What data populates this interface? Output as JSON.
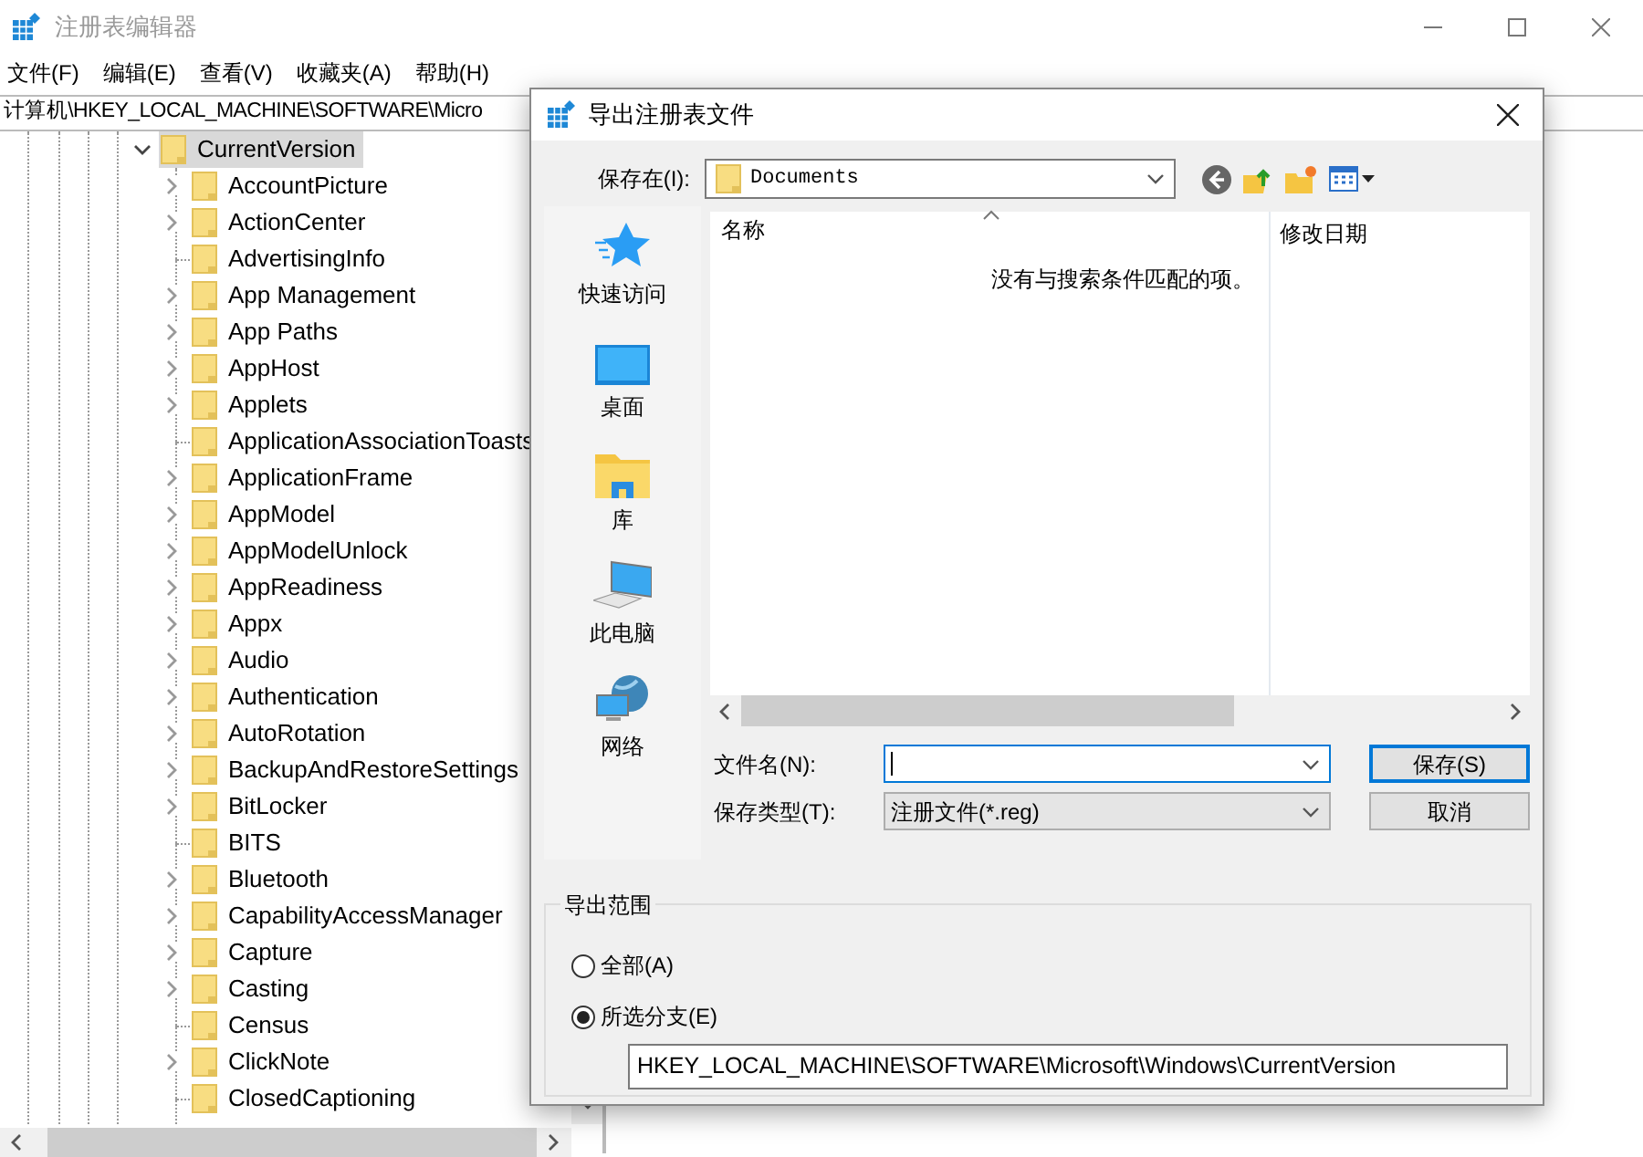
{
  "window": {
    "title": "注册表编辑器"
  },
  "menu": [
    "文件(F)",
    "编辑(E)",
    "查看(V)",
    "收藏夹(A)",
    "帮助(H)"
  ],
  "address_bar": {
    "value": "计算机\\HKEY_LOCAL_MACHINE\\SOFTWARE\\Micro"
  },
  "tree": [
    {
      "label": "CurrentVersion",
      "expanded": true,
      "selected": true,
      "children": [
        {
          "label": "AccountPicture",
          "expandable": true,
          "selected": false
        },
        {
          "label": "ActionCenter",
          "expandable": true,
          "selected": false
        },
        {
          "label": "AdvertisingInfo",
          "expandable": false,
          "selected": false
        },
        {
          "label": "App Management",
          "expandable": true,
          "selected": false
        },
        {
          "label": "App Paths",
          "expandable": true,
          "selected": false
        },
        {
          "label": "AppHost",
          "expandable": true,
          "selected": false
        },
        {
          "label": "Applets",
          "expandable": true,
          "selected": false
        },
        {
          "label": "ApplicationAssociationToasts",
          "expandable": false,
          "selected": false
        },
        {
          "label": "ApplicationFrame",
          "expandable": true,
          "selected": false
        },
        {
          "label": "AppModel",
          "expandable": true,
          "selected": false
        },
        {
          "label": "AppModelUnlock",
          "expandable": true,
          "selected": false
        },
        {
          "label": "AppReadiness",
          "expandable": true,
          "selected": false
        },
        {
          "label": "Appx",
          "expandable": true,
          "selected": false
        },
        {
          "label": "Audio",
          "expandable": true,
          "selected": false
        },
        {
          "label": "Authentication",
          "expandable": true,
          "selected": false
        },
        {
          "label": "AutoRotation",
          "expandable": true,
          "selected": false
        },
        {
          "label": "BackupAndRestoreSettings",
          "expandable": true,
          "selected": false
        },
        {
          "label": "BitLocker",
          "expandable": true,
          "selected": false
        },
        {
          "label": "BITS",
          "expandable": false,
          "selected": false
        },
        {
          "label": "Bluetooth",
          "expandable": true,
          "selected": false
        },
        {
          "label": "CapabilityAccessManager",
          "expandable": true,
          "selected": false
        },
        {
          "label": "Capture",
          "expandable": true,
          "selected": false
        },
        {
          "label": "Casting",
          "expandable": true,
          "selected": false
        },
        {
          "label": "Census",
          "expandable": false,
          "selected": false
        },
        {
          "label": "ClickNote",
          "expandable": true,
          "selected": false
        },
        {
          "label": "ClosedCaptioning",
          "expandable": false,
          "selected": false
        }
      ]
    }
  ],
  "dialog": {
    "title": "导出注册表文件",
    "save_in": {
      "label": "保存在(I):",
      "value": "Documents"
    },
    "places": [
      {
        "label": "快速访问",
        "kind": "star"
      },
      {
        "label": "桌面",
        "kind": "desktop"
      },
      {
        "label": "库",
        "kind": "library"
      },
      {
        "label": "此电脑",
        "kind": "computer"
      },
      {
        "label": "网络",
        "kind": "network"
      }
    ],
    "columns": [
      "名称",
      "修改日期"
    ],
    "empty_message": "没有与搜索条件匹配的项。",
    "file_name": {
      "label": "文件名(N):"
    },
    "file_type": {
      "label": "保存类型(T):",
      "value": "注册文件(*.reg)"
    },
    "buttons": [
      {
        "label": "保存(S)",
        "default": true
      },
      {
        "label": "取消",
        "default": false
      }
    ],
    "export_range": {
      "title": "导出范围",
      "options": [
        {
          "label": "全部(A)",
          "selected": false
        },
        {
          "label": "所选分支(E)",
          "selected": true
        }
      ],
      "branch_path": "HKEY_LOCAL_MACHINE\\SOFTWARE\\Microsoft\\Windows\\CurrentVersion"
    }
  }
}
